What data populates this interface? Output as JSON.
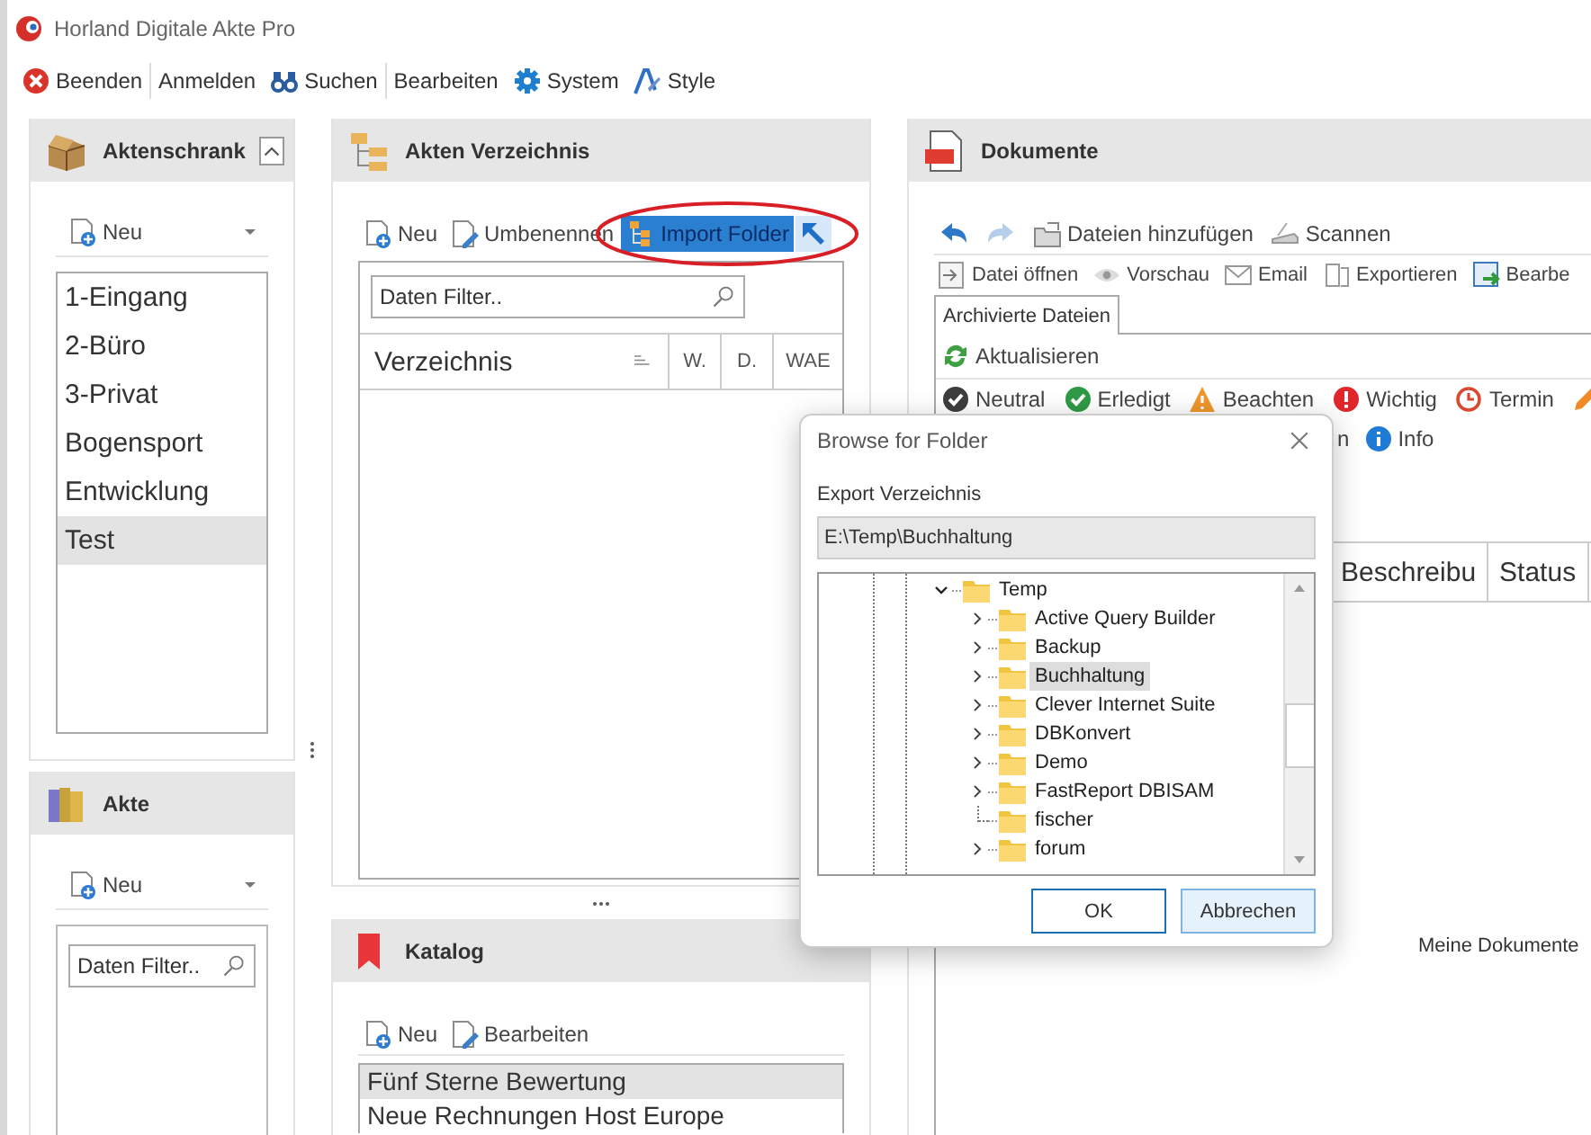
{
  "window": {
    "title": "Horland Digitale Akte Pro"
  },
  "menu": [
    {
      "label": "Beenden",
      "kind": "exit",
      "divider_after": true
    },
    {
      "label": "Anmelden",
      "divider_after": false
    },
    {
      "label": "Suchen",
      "kind": "binoculars",
      "divider_after": true
    },
    {
      "label": "Bearbeiten",
      "divider_after": false
    },
    {
      "label": "System",
      "kind": "gear",
      "divider_after": false
    },
    {
      "label": "Style",
      "kind": "brush",
      "divider_after": false
    }
  ],
  "aktenschrank": {
    "title": "Aktenschrank",
    "new_label": "Neu",
    "items": [
      {
        "label": "1-Eingang",
        "selected": false
      },
      {
        "label": "2-Büro",
        "selected": false
      },
      {
        "label": "3-Privat",
        "selected": false
      },
      {
        "label": "Bogensport",
        "selected": false
      },
      {
        "label": "Entwicklung",
        "selected": false
      },
      {
        "label": "Test",
        "selected": true
      }
    ]
  },
  "akte": {
    "title": "Akte",
    "new_label": "Neu",
    "filter": {
      "placeholder": "Daten Filter.."
    }
  },
  "verzeichnis": {
    "title": "Akten Verzeichnis",
    "toolbar": [
      {
        "label": "Neu",
        "kind": "new",
        "highlighted": false
      },
      {
        "label": "Umbenennen",
        "kind": "rename",
        "highlighted": false
      },
      {
        "label": "Import Folder",
        "kind": "import",
        "highlighted": true
      }
    ],
    "filter": {
      "placeholder": "Daten Filter.."
    },
    "columns": [
      "Verzeichnis",
      "W.",
      "D.",
      "WAE"
    ]
  },
  "katalog": {
    "title": "Katalog",
    "toolbar": [
      {
        "label": "Neu",
        "kind": "new"
      },
      {
        "label": "Bearbeiten",
        "kind": "rename"
      }
    ],
    "items": [
      {
        "label": "Fünf Sterne Bewertung",
        "selected": true
      },
      {
        "label": "Neue Rechnungen Host Europe",
        "selected": false
      }
    ]
  },
  "dokumente": {
    "title": "Dokumente",
    "toolbar1": [
      {
        "kind": "back",
        "disabled": false
      },
      {
        "kind": "forward",
        "disabled": true
      },
      {
        "label": "Dateien hinzufügen",
        "kind": "addfiles",
        "disabled": false
      },
      {
        "label": "Scannen",
        "kind": "scan",
        "disabled": false
      }
    ],
    "toolbar2": [
      {
        "label": "Datei öffnen",
        "kind": "open"
      },
      {
        "label": "Vorschau",
        "kind": "eye"
      },
      {
        "label": "Email",
        "kind": "mail"
      },
      {
        "label": "Exportieren",
        "kind": "export"
      },
      {
        "label": "Bearbe",
        "kind": "editgreen"
      }
    ],
    "tabs": [
      {
        "label": "Archivierte Dateien",
        "selected": true
      }
    ],
    "refresh": "Aktualisieren",
    "status_row1": [
      {
        "label": "Neutral",
        "kind": "neutral"
      },
      {
        "label": "Erledigt",
        "kind": "done"
      },
      {
        "label": "Beachten",
        "kind": "warning"
      },
      {
        "label": "Wichtig",
        "kind": "important"
      },
      {
        "label": "Termin",
        "kind": "clock"
      },
      {
        "kind": "pencil"
      }
    ],
    "status_row2": [
      {
        "label": "n"
      },
      {
        "label": "Info",
        "kind": "info"
      }
    ],
    "columns": [
      "Beschreibu",
      "Status"
    ],
    "empty_text": "Meine Dokumente"
  },
  "dialog": {
    "title": "Browse for Folder",
    "label": "Export Verzeichnis",
    "path": "E:\\Temp\\Buchhaltung",
    "tree": {
      "label": "Temp",
      "expanded": true,
      "children": [
        {
          "label": "Active Query Builder",
          "expandable": true,
          "selected": false
        },
        {
          "label": "Backup",
          "expandable": true,
          "selected": false
        },
        {
          "label": "Buchhaltung",
          "expandable": true,
          "selected": true
        },
        {
          "label": "Clever Internet Suite",
          "expandable": true,
          "selected": false
        },
        {
          "label": "DBKonvert",
          "expandable": true,
          "selected": false
        },
        {
          "label": "Demo",
          "expandable": true,
          "selected": false
        },
        {
          "label": "FastReport DBISAM",
          "expandable": true,
          "selected": false
        },
        {
          "label": "fischer",
          "expandable": false,
          "selected": false
        },
        {
          "label": "forum",
          "expandable": true,
          "selected": false
        }
      ]
    },
    "buttons": [
      {
        "label": "OK",
        "default": false
      },
      {
        "label": "Abbrechen",
        "default": true
      }
    ]
  }
}
